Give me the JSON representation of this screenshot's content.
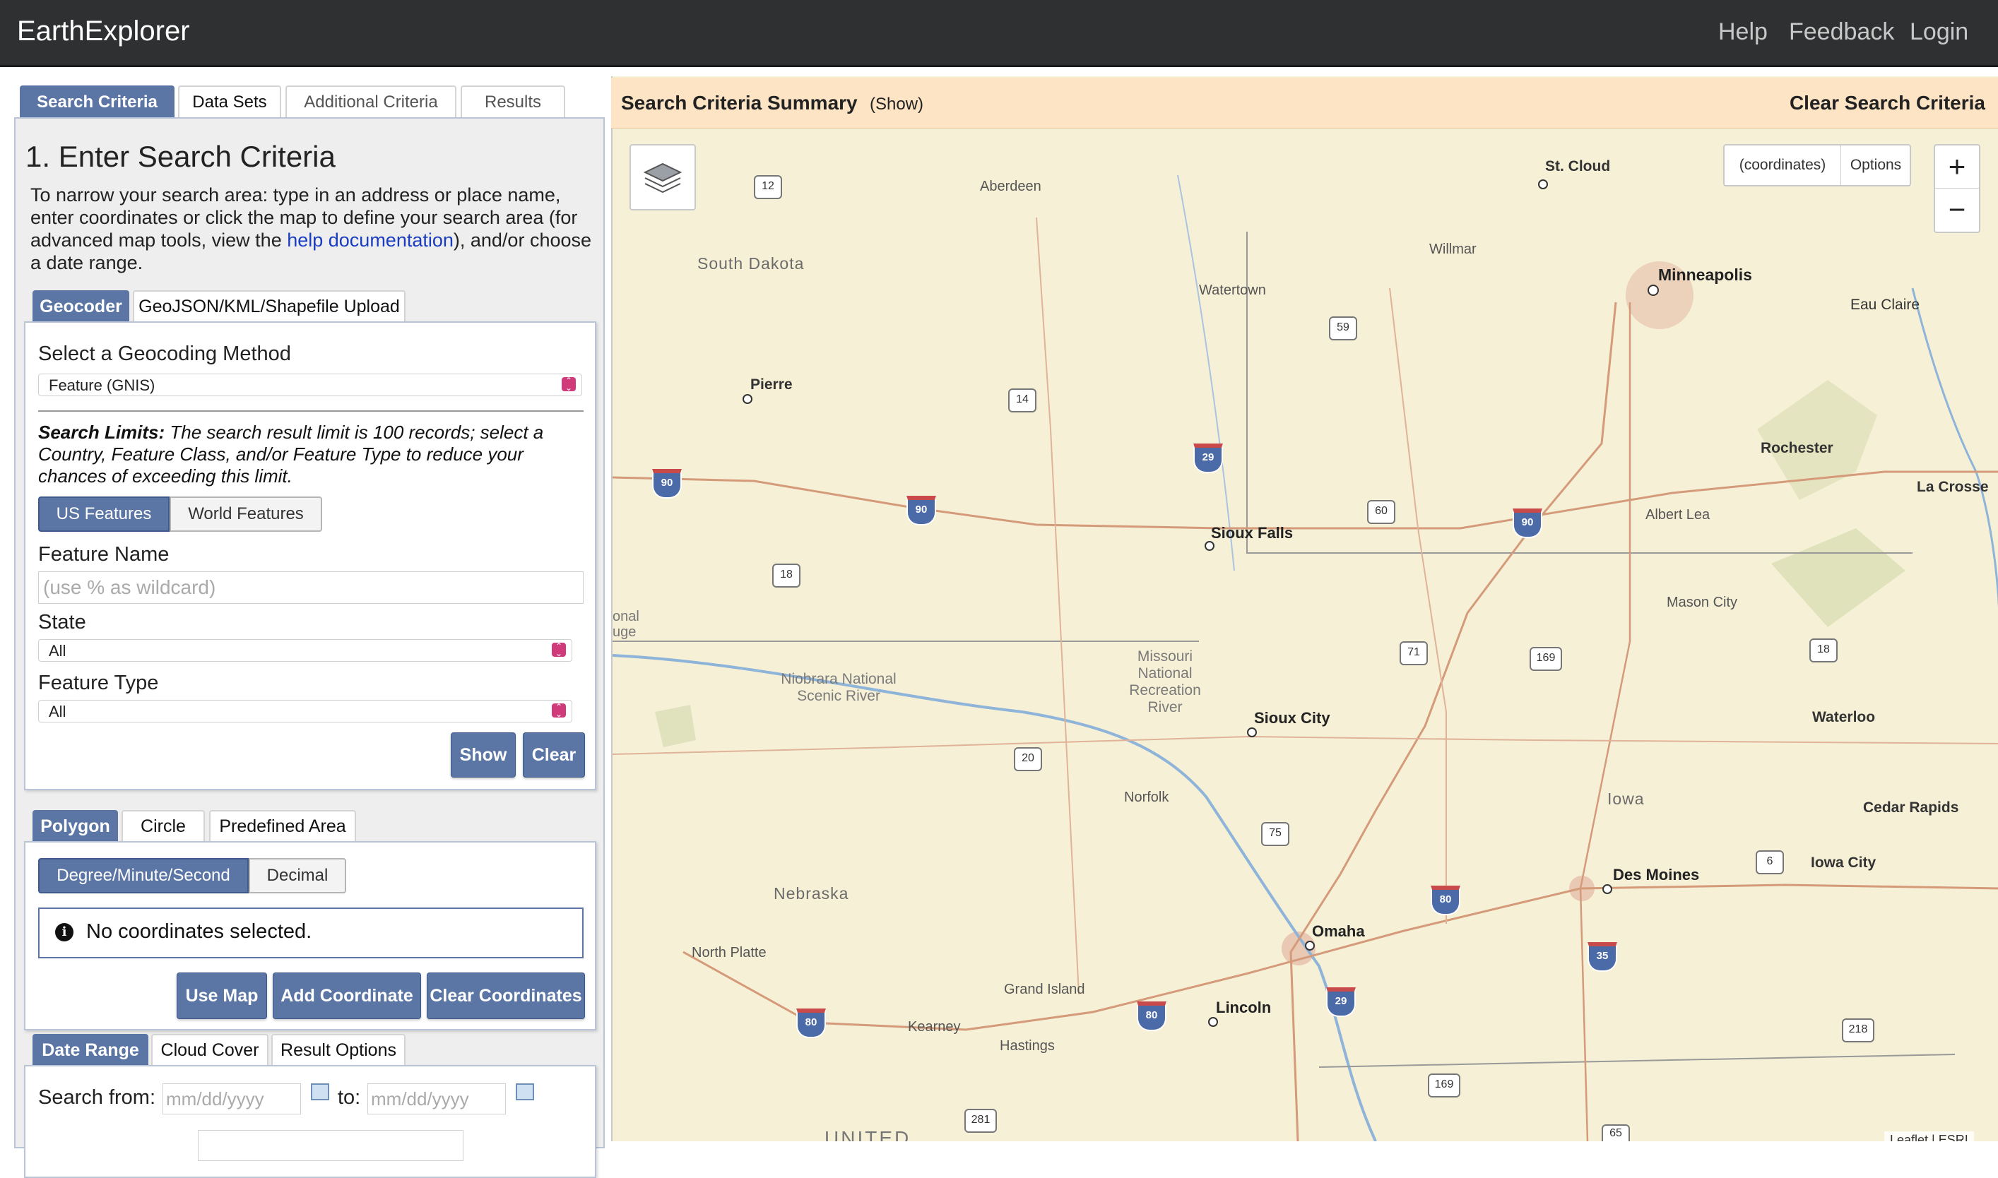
{
  "header": {
    "app_title": "EarthExplorer",
    "nav": [
      "Help",
      "Feedback",
      "Login"
    ]
  },
  "main_tabs": [
    {
      "label": "Search Criteria",
      "active": true
    },
    {
      "label": "Data Sets",
      "active": false
    },
    {
      "label": "Additional Criteria",
      "active": false
    },
    {
      "label": "Results",
      "active": false
    }
  ],
  "search_panel": {
    "heading": "1. Enter Search Criteria",
    "intro_before": "To narrow your search area: type in an address or place name, enter coordinates or click the map to define your search area (for advanced map tools, view the ",
    "intro_link": "help documentation",
    "intro_after": "), and/or choose a date range.",
    "geo_tabs": [
      "Geocoder",
      "GeoJSON/KML/Shapefile Upload"
    ],
    "geocoding_label": "Select a Geocoding Method",
    "geocoding_value": "Feature (GNIS)",
    "limits_bold": "Search Limits:",
    "limits_text": " The search result limit is 100 records; select a Country, Feature Class, and/or Feature Type to reduce your chances of exceeding this limit.",
    "feature_toggle": [
      "US Features",
      "World Features"
    ],
    "feature_name_label": "Feature Name",
    "feature_name_placeholder": "(use % as wildcard)",
    "state_label": "State",
    "state_value": "All",
    "feature_type_label": "Feature Type",
    "feature_type_value": "All",
    "show_button": "Show",
    "clear_button": "Clear"
  },
  "area_panel": {
    "tabs": [
      "Polygon",
      "Circle",
      "Predefined Area"
    ],
    "format_toggle": [
      "Degree/Minute/Second",
      "Decimal"
    ],
    "info_text": "No coordinates selected.",
    "use_map_button": "Use Map",
    "add_coordinate_button": "Add Coordinate",
    "clear_coordinates_button": "Clear Coordinates"
  },
  "date_panel": {
    "tabs": [
      "Date Range",
      "Cloud Cover",
      "Result Options"
    ],
    "search_from_label": "Search from:",
    "from_placeholder": "mm/dd/yyyy",
    "to_label": "to:",
    "to_placeholder": "mm/dd/yyyy"
  },
  "map": {
    "summary_title": "Search Criteria Summary",
    "summary_show": "(Show)",
    "clear_criteria": "Clear Search Criteria",
    "coordinates_btn": "(coordinates)",
    "options_btn": "Options",
    "zoom_in": "+",
    "zoom_out": "−",
    "cities": [
      "St. Cloud",
      "Aberdeen",
      "Minneapolis",
      "Eau Claire",
      "Willmar",
      "Watertown",
      "Pierre",
      "Rochester",
      "La Crosse",
      "Sioux Falls",
      "Albert Lea",
      "Mason City",
      "Sioux City",
      "Waterloo",
      "Norfolk",
      "Cedar Rapids",
      "Des Moines",
      "Iowa City",
      "Omaha",
      "North Platte",
      "Grand Island",
      "Lincoln",
      "Kearney",
      "Hastings"
    ],
    "regions": [
      "South Dakota",
      "Nebraska",
      "Iowa"
    ],
    "parks": [
      "Niobrara National Scenic River",
      "Missouri National Recreation River"
    ],
    "edge_labels": [
      "onal",
      "uge",
      "UNITED"
    ],
    "interstate_shields": [
      "90",
      "90",
      "29",
      "90",
      "80",
      "29",
      "80",
      "80",
      "35"
    ],
    "us_shields": [
      "12",
      "14",
      "18",
      "59",
      "60",
      "71",
      "169",
      "18",
      "20",
      "75",
      "6",
      "281",
      "169",
      "218",
      "65"
    ],
    "attribution": "Leaflet | ESRI"
  }
}
